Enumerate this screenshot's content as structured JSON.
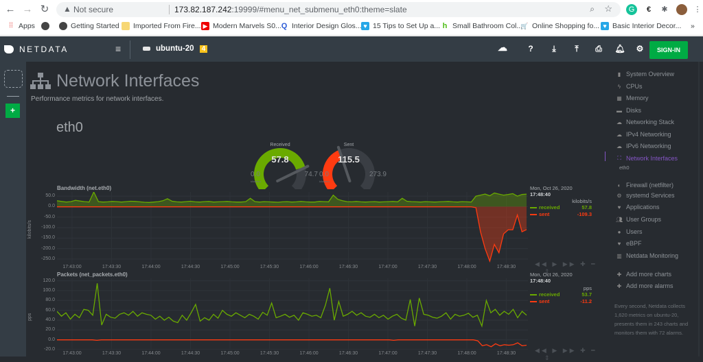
{
  "browser": {
    "security_label": "Not secure",
    "url_host": "173.82.187.242",
    "url_rest": ":19999/#menu_net_submenu_eth0:theme=slate",
    "bookmarks": [
      {
        "icon": "apps-icon",
        "label": "Apps"
      },
      {
        "icon": "globe-icon",
        "label": ""
      },
      {
        "icon": "globe-icon",
        "label": "Getting Started"
      },
      {
        "icon": "folder-icon",
        "label": "Imported From Fire..."
      },
      {
        "icon": "youtube-icon",
        "label": "Modern Marvels S0..."
      },
      {
        "icon": "q-icon",
        "label": "Interior Design Glos..."
      },
      {
        "icon": "heart-icon",
        "label": "15 Tips to Set Up a..."
      },
      {
        "icon": "houzz-icon",
        "label": "Small Bathroom Col..."
      },
      {
        "icon": "cart-icon",
        "label": "Online Shopping fo..."
      },
      {
        "icon": "heart-icon",
        "label": "Basic Interior Decor..."
      }
    ],
    "more_bookmarks": "»"
  },
  "header": {
    "brand": "NETDATA",
    "host": "ubuntu-20",
    "alarm_count": "4",
    "signin_label": "SIGN-IN",
    "accent": "#00ab44"
  },
  "section": {
    "title": "Network Interfaces",
    "description": "Performance metrics for network interfaces.",
    "subsection": "eth0"
  },
  "gauges": [
    {
      "label": "Received",
      "value": "57.8",
      "min": "0.0",
      "max": "74.7",
      "unit": "kilobits/s",
      "fraction": 0.774,
      "color": "#6aaa00"
    },
    {
      "label": "Sent",
      "value": "115.5",
      "min": "0.0",
      "max": "273.9",
      "unit": "kilobits/s",
      "fraction": 0.422,
      "color": "#ff3b11"
    }
  ],
  "chart_data": [
    {
      "type": "area",
      "title": "Bandwidth (net.eth0)",
      "ylabel": "kilobits/s",
      "ylim": [
        -270,
        70
      ],
      "yticks": [
        "50.0",
        "0.0",
        "-50.0",
        "-100.0",
        "-150.0",
        "-200.0",
        "-250.0"
      ],
      "ytick_values": [
        50,
        0,
        -50,
        -100,
        -150,
        -200,
        -250
      ],
      "xticks": [
        "17:43:00",
        "17:43:30",
        "17:44:00",
        "17:44:30",
        "17:45:00",
        "17:45:30",
        "17:46:00",
        "17:46:30",
        "17:47:00",
        "17:47:30",
        "17:48:00",
        "17:48:30"
      ],
      "legend": {
        "date": "Mon, Oct 26, 2020",
        "time": "17:48:40",
        "unit": "kilobits/s"
      },
      "series": [
        {
          "name": "received",
          "value": "57.8",
          "color": "#6aaa00",
          "values": [
            28,
            25,
            22,
            24,
            30,
            27,
            24,
            22,
            70,
            24,
            22,
            23,
            25,
            24,
            22,
            24,
            26,
            25,
            23,
            21,
            20,
            22,
            24,
            28,
            38,
            26,
            23,
            22,
            24,
            26,
            23,
            22,
            24,
            25,
            22,
            23,
            24,
            25,
            23,
            22,
            22,
            24,
            40,
            24,
            22,
            24,
            23,
            22,
            21,
            23,
            24,
            22,
            23,
            25,
            23,
            22,
            22,
            25,
            24,
            23,
            55,
            35,
            28,
            24,
            23,
            25,
            23,
            22,
            23,
            24,
            22,
            23,
            24,
            25,
            23,
            40,
            26,
            24,
            23,
            22,
            24,
            23,
            22,
            23,
            24,
            25,
            23,
            22,
            24,
            23,
            22,
            50,
            55,
            60,
            52,
            65,
            60,
            55,
            58,
            62,
            50,
            58,
            60
          ]
        },
        {
          "name": "sent",
          "value": "-109.3",
          "color": "#ff3b11",
          "values": [
            -1,
            -1,
            -1,
            -1,
            -1,
            -1,
            -1,
            -1,
            -1,
            -1,
            -1,
            -1,
            -1,
            -1,
            -1,
            -1,
            -1,
            -1,
            -1,
            -1,
            -1,
            -1,
            -1,
            -1,
            -1,
            -1,
            -1,
            -1,
            -1,
            -1,
            -1,
            -1,
            -1,
            -1,
            -1,
            -1,
            -1,
            -1,
            -1,
            -1,
            -1,
            -1,
            -1,
            -1,
            -1,
            -1,
            -1,
            -1,
            -1,
            -1,
            -1,
            -1,
            -1,
            -1,
            -1,
            -1,
            -1,
            -1,
            -1,
            -1,
            -1,
            -1,
            -1,
            -1,
            -1,
            -1,
            -1,
            -1,
            -1,
            -1,
            -1,
            -1,
            -1,
            -1,
            -1,
            -1,
            -1,
            -1,
            -1,
            -1,
            -1,
            -1,
            -1,
            -1,
            -1,
            -1,
            -1,
            -1,
            -1,
            -1,
            -1,
            -5,
            -120,
            -200,
            -260,
            -180,
            -220,
            -130,
            -110,
            -110,
            -40,
            -120,
            -109
          ]
        }
      ]
    },
    {
      "type": "line",
      "title": "Packets (net_packets.eth0)",
      "ylabel": "pps",
      "ylim": [
        -20,
        125
      ],
      "yticks": [
        "120.0",
        "100.0",
        "80.0",
        "60.0",
        "40.0",
        "20.0",
        "0.0",
        "-20.0"
      ],
      "ytick_values": [
        120,
        100,
        80,
        60,
        40,
        20,
        0,
        -20
      ],
      "xticks": [
        "17:43:00",
        "17:43:30",
        "17:44:00",
        "17:44:30",
        "17:45:00",
        "17:45:30",
        "17:46:00",
        "17:46:30",
        "17:47:00",
        "17:47:30",
        "17:48:00",
        "17:48:30"
      ],
      "legend": {
        "date": "Mon, Oct 26, 2020",
        "time": "17:48:40",
        "unit": "pps"
      },
      "series": [
        {
          "name": "received",
          "value": "53.7",
          "color": "#6aaa00",
          "values": [
            58,
            48,
            55,
            42,
            52,
            45,
            62,
            60,
            50,
            115,
            30,
            52,
            46,
            44,
            52,
            55,
            50,
            58,
            48,
            55,
            52,
            50,
            42,
            48,
            40,
            46,
            38,
            35,
            50,
            40,
            55,
            72,
            38,
            45,
            40,
            52,
            44,
            60,
            52,
            48,
            55,
            50,
            45,
            52,
            48,
            42,
            56,
            50,
            75,
            45,
            48,
            52,
            46,
            50,
            40,
            55,
            52,
            48,
            50,
            45,
            70,
            105,
            40,
            78,
            48,
            52,
            58,
            50,
            55,
            48,
            46,
            52,
            45,
            50,
            42,
            48,
            52,
            44,
            40,
            82,
            28,
            85,
            52,
            50,
            46,
            44,
            48,
            55,
            42,
            52,
            48,
            50,
            54,
            46,
            50,
            28,
            80,
            55,
            62,
            50,
            58,
            52,
            62,
            45,
            58,
            50
          ]
        },
        {
          "name": "sent",
          "value": "-11.2",
          "color": "#ff3b11",
          "values": [
            0,
            0,
            0,
            0,
            0,
            0,
            0,
            0,
            0,
            -1,
            0,
            0,
            0,
            0,
            0,
            0,
            0,
            0,
            0,
            0,
            0,
            0,
            0,
            0,
            0,
            0,
            0,
            0,
            0,
            0,
            0,
            0,
            0,
            0,
            0,
            0,
            0,
            0,
            0,
            0,
            0,
            0,
            0,
            0,
            0,
            0,
            0,
            0,
            0,
            0,
            0,
            0,
            0,
            0,
            0,
            0,
            0,
            0,
            0,
            0,
            0,
            0,
            0,
            0,
            0,
            0,
            0,
            0,
            0,
            0,
            0,
            0,
            0,
            0,
            0,
            0,
            -1,
            0,
            0,
            0,
            0,
            0,
            0,
            0,
            0,
            0,
            0,
            0,
            0,
            0,
            0,
            0,
            0,
            0,
            0,
            -2,
            -12,
            -10,
            -14,
            -8,
            -12,
            -10,
            -11,
            -10,
            -6,
            -12,
            -11
          ]
        }
      ]
    }
  ],
  "sidebar": {
    "items": [
      {
        "icon": "bookmark-icon",
        "label": "System Overview"
      },
      {
        "icon": "bolt-icon",
        "label": "CPUs"
      },
      {
        "icon": "memory-icon",
        "label": "Memory"
      },
      {
        "icon": "disk-icon",
        "label": "Disks"
      },
      {
        "icon": "cloud-icon",
        "label": "Networking Stack"
      },
      {
        "icon": "cloud-icon",
        "label": "IPv4 Networking"
      },
      {
        "icon": "cloud-icon",
        "label": "IPv6 Networking"
      },
      {
        "icon": "sitemap-icon",
        "label": "Network Interfaces",
        "active": true
      },
      {
        "icon": "shield-icon",
        "label": "Firewall (netfilter)"
      },
      {
        "icon": "cogs-icon",
        "label": "systemd Services"
      },
      {
        "icon": "heartbeat-icon",
        "label": "Applications"
      },
      {
        "icon": "users-icon",
        "label": "User Groups"
      },
      {
        "icon": "user-icon",
        "label": "Users"
      },
      {
        "icon": "heartbeat-icon",
        "label": "eBPF"
      },
      {
        "icon": "chart-icon",
        "label": "Netdata Monitoring"
      }
    ],
    "active_sub": "eth0",
    "add_charts": "Add more charts",
    "add_alarms": "Add more alarms",
    "summary": "Every second, Netdata collects 1,620 metrics on ubuntu-20, presents them in 243 charts and monitors them with 72 alarms.",
    "active_color": "#8455c4"
  }
}
